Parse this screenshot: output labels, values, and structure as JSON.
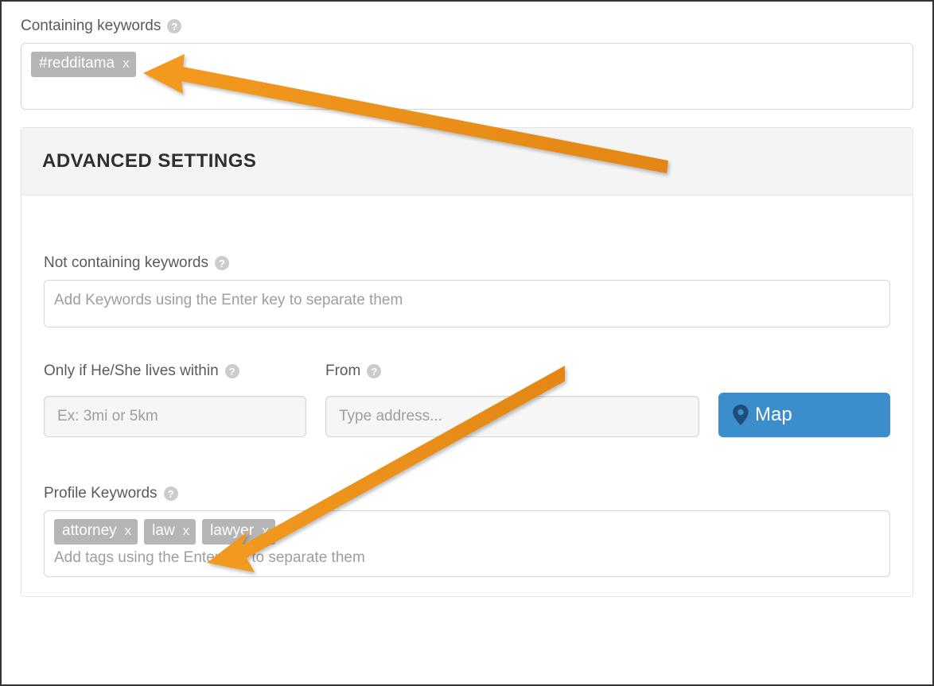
{
  "containing": {
    "label": "Containing keywords",
    "tags": [
      {
        "text": "#redditama"
      }
    ]
  },
  "advanced": {
    "title": "ADVANCED SETTINGS",
    "not_containing": {
      "label": "Not containing keywords",
      "placeholder": "Add Keywords using the Enter key to separate them"
    },
    "distance": {
      "label": "Only if He/She lives within",
      "placeholder": "Ex: 3mi or 5km"
    },
    "from": {
      "label": "From",
      "placeholder": "Type address..."
    },
    "map_button": "Map",
    "profile_keywords": {
      "label": "Profile Keywords",
      "placeholder": "Add tags using the Enter key to separate them",
      "tags": [
        {
          "text": "attorney"
        },
        {
          "text": "law"
        },
        {
          "text": "lawyer"
        }
      ]
    }
  },
  "glyphs": {
    "remove": "x",
    "help": "?"
  }
}
